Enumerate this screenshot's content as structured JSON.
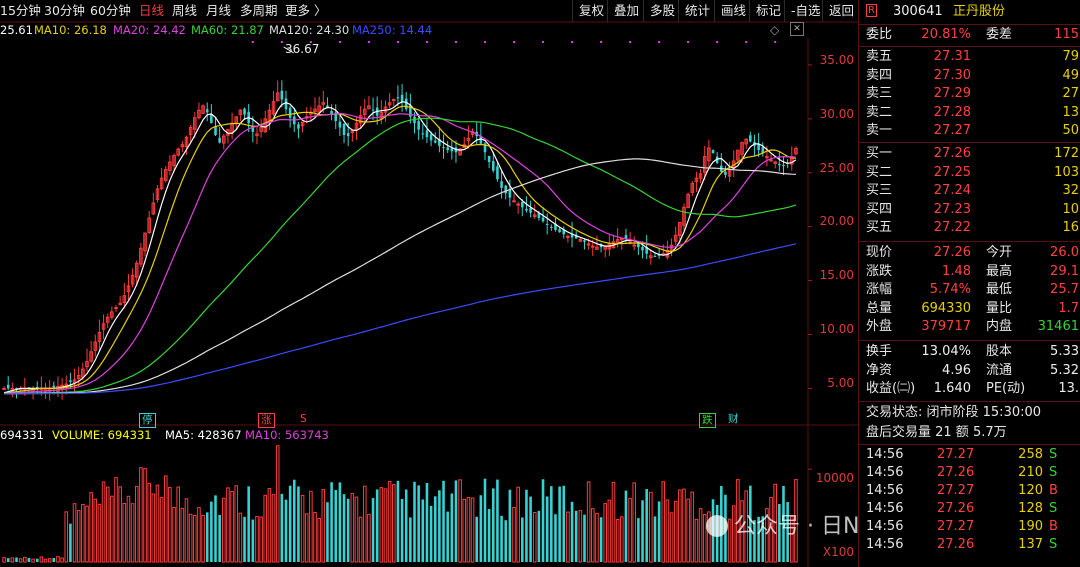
{
  "toolbar": {
    "tabs": [
      "15分钟",
      "30分钟",
      "60分钟",
      "日线",
      "周线",
      "月线",
      "多周期",
      "更多 〉"
    ],
    "active_tab": "日线",
    "buttons": [
      "复权",
      "叠加",
      "多股",
      "统计",
      "画线",
      "标记",
      "-自选",
      "返回"
    ]
  },
  "ma_legend": [
    {
      "label": "25.61",
      "color": "#ffffff"
    },
    {
      "label": "MA10: 26.18",
      "color": "#e8d000"
    },
    {
      "label": "MA20: 24.42",
      "color": "#e040e0"
    },
    {
      "label": "MA60: 21.87",
      "color": "#35d435"
    },
    {
      "label": "MA120: 24.30",
      "color": "#dddddd"
    },
    {
      "label": "MA250: 14.44",
      "color": "#3a4cff"
    }
  ],
  "price_axis": [
    "35.00",
    "30.00",
    "25.00",
    "20.00",
    "15.00",
    "10.00",
    "5.00"
  ],
  "peak_label": "36.67",
  "markers": [
    {
      "text": "停",
      "color": "#35d4d4"
    },
    {
      "text": "涨",
      "color": "#ff4040"
    },
    {
      "text": "S",
      "color": "#ff4040"
    },
    {
      "text": "跌",
      "color": "#35d435"
    },
    {
      "text": "财",
      "color": "#35d4d4"
    }
  ],
  "volume_legend": [
    {
      "label": "694331",
      "color": "#ffffff"
    },
    {
      "label": "VOLUME: 694331",
      "color": "#ffff00"
    },
    {
      "label": "MA5: 428367",
      "color": "#ffffff"
    },
    {
      "label": "MA10: 563743",
      "color": "#e040e0"
    }
  ],
  "volume_axis": [
    "10000",
    "X100"
  ],
  "chart_data": {
    "type": "candlestick",
    "ylim": [
      3,
      37.5
    ],
    "price_ticks": [
      35,
      30,
      25,
      20,
      15,
      10,
      5
    ],
    "peak": 36.67,
    "closes": [
      5,
      5,
      5,
      5,
      5,
      5,
      5,
      5,
      5,
      5,
      5,
      5,
      5.1,
      5.2,
      5.3,
      5.4,
      5.6,
      5.8,
      6.2,
      6.8,
      7.5,
      8.4,
      9.3,
      10.2,
      11,
      11.6,
      12.1,
      12.5,
      12.9,
      13.6,
      14.5,
      15.5,
      16.6,
      18,
      19.4,
      20.8,
      22.2,
      23.5,
      24.5,
      25.3,
      26,
      26.6,
      27.2,
      27.6,
      28.3,
      29.2,
      30.1,
      30.8,
      31.2,
      30.6,
      29.6,
      28.5,
      27.8,
      28.4,
      29,
      29.6,
      30.2,
      30.8,
      30.4,
      29.6,
      28.8,
      28.6,
      29.2,
      30,
      30.8,
      31.6,
      32.4,
      31.8,
      30.9,
      30.1,
      29.5,
      29.1,
      29.7,
      30.2,
      30.6,
      30.9,
      31.2,
      31.5,
      31.1,
      30.4,
      29.8,
      29.2,
      28.5,
      28.4,
      28.9,
      29.6,
      30.3,
      30.9,
      31.2,
      30.8,
      30.3,
      30.6,
      31.1,
      31.5,
      31.8,
      31.9,
      31.6,
      30.9,
      30.2,
      29.6,
      29,
      28.6,
      28.3,
      28,
      27.8,
      27.5,
      27.3,
      27.1,
      27,
      26.9,
      27.2,
      27.6,
      28.2,
      28.8,
      28.4,
      27.7,
      26.9,
      26,
      25.2,
      24.4,
      23.6,
      23.1,
      22.7,
      22.4,
      22.1,
      21.8,
      21.5,
      21.3,
      21.1,
      20.8,
      20.5,
      20.2,
      19.9,
      19.7,
      19.5,
      19.3,
      19.1,
      19,
      18.9,
      18.8,
      18.6,
      18.4,
      18.2,
      18.1,
      18.1,
      18.2,
      18.4,
      18.6,
      18.8,
      18.9,
      18.9,
      18.6,
      18.3,
      18.1,
      17.8,
      17.5,
      17.3,
      17.2,
      17.3,
      17.5,
      17.8,
      18.3,
      19.2,
      20.4,
      21.8,
      23,
      24,
      24.5,
      24.9,
      26.5,
      27.3,
      26.8,
      25.9,
      25.1,
      24.8,
      25.2,
      26.1,
      27.1,
      27.8,
      28.1,
      27.9,
      27.5,
      27.1,
      26.8,
      26.5,
      26.2,
      26,
      25.7,
      25.61,
      25.9,
      26.5,
      27.26
    ],
    "ma10": 26.18,
    "ma20": 24.42,
    "ma60": 21.87,
    "ma120": 24.3,
    "ma250": 14.44,
    "volume": 694331,
    "vol_ma5": 428367,
    "vol_ma10": 563743,
    "vol_ticks": [
      10000
    ]
  },
  "quote": {
    "stock_code": "300641",
    "stock_name": "正丹股份",
    "weibi_label": "委比",
    "weibi_value": "20.81%",
    "weicha_label": "委差",
    "weicha_value": "115",
    "asks": [
      {
        "label": "卖五",
        "price": "27.31",
        "qty": "79"
      },
      {
        "label": "卖四",
        "price": "27.30",
        "qty": "49"
      },
      {
        "label": "卖三",
        "price": "27.29",
        "qty": "27"
      },
      {
        "label": "卖二",
        "price": "27.28",
        "qty": "13"
      },
      {
        "label": "卖一",
        "price": "27.27",
        "qty": "50"
      }
    ],
    "bids": [
      {
        "label": "买一",
        "price": "27.26",
        "qty": "172"
      },
      {
        "label": "买二",
        "price": "27.25",
        "qty": "103"
      },
      {
        "label": "买三",
        "price": "27.24",
        "qty": "32"
      },
      {
        "label": "买四",
        "price": "27.23",
        "qty": "10"
      },
      {
        "label": "买五",
        "price": "27.22",
        "qty": "16"
      }
    ],
    "stats": [
      {
        "l1": "现价",
        "v1": "27.26",
        "c1": "red",
        "l2": "今开",
        "v2": "26.0",
        "c2": "red"
      },
      {
        "l1": "涨跌",
        "v1": "1.48",
        "c1": "red",
        "l2": "最高",
        "v2": "29.1",
        "c2": "red"
      },
      {
        "l1": "涨幅",
        "v1": "5.74%",
        "c1": "red",
        "l2": "最低",
        "v2": "25.7",
        "c2": "red"
      },
      {
        "l1": "总量",
        "v1": "694330",
        "c1": "yellow",
        "l2": "量比",
        "v2": "1.7",
        "c2": "red"
      },
      {
        "l1": "外盘",
        "v1": "379717",
        "c1": "red",
        "l2": "内盘",
        "v2": "31461",
        "c2": "green"
      },
      {
        "l1": "换手",
        "v1": "13.04%",
        "c1": "white",
        "l2": "股本",
        "v2": "5.33",
        "c2": "white"
      },
      {
        "l1": "净资",
        "v1": "4.96",
        "c1": "white",
        "l2": "流通",
        "v2": "5.32",
        "c2": "white"
      },
      {
        "l1": "收益(㈡)",
        "v1": "1.640",
        "c1": "white",
        "l2": "PE(动)",
        "v2": "13.",
        "c2": "white"
      }
    ],
    "trade_status": "交易状态: 闭市阶段 15:30:00",
    "after_hours": "盘后交易量 21 额 5.7万",
    "ticks": [
      {
        "time": "14:56",
        "price": "27.27",
        "vol": "258",
        "side": "S"
      },
      {
        "time": "14:56",
        "price": "27.26",
        "vol": "210",
        "side": "S"
      },
      {
        "time": "14:56",
        "price": "27.27",
        "vol": "120",
        "side": "B"
      },
      {
        "time": "14:56",
        "price": "27.26",
        "vol": "128",
        "side": "S"
      },
      {
        "time": "14:56",
        "price": "27.27",
        "vol": "190",
        "side": "B"
      },
      {
        "time": "14:56",
        "price": "27.26",
        "vol": "137",
        "side": "S"
      }
    ]
  },
  "watermark": "公众号 · 日N资本论"
}
